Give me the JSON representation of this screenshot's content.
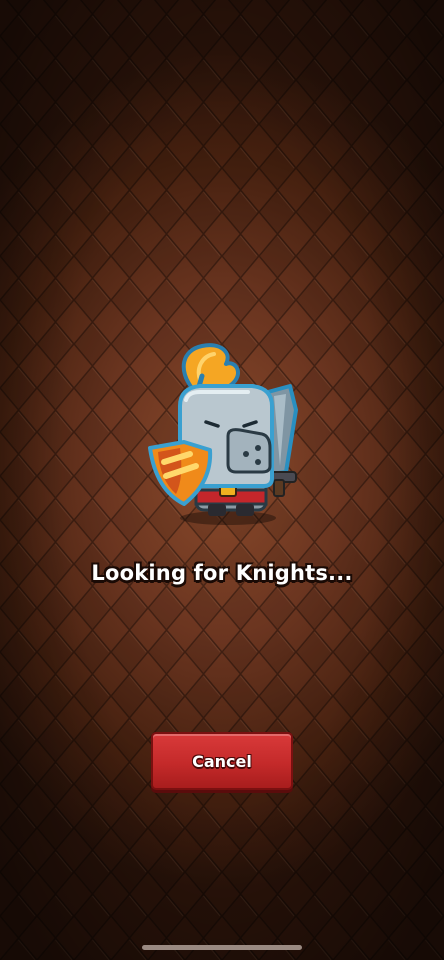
{
  "matchmaking": {
    "status_text": "Looking for Knights...",
    "cancel_label": "Cancel"
  },
  "character": {
    "icon": "knight-icon",
    "items": [
      "plume-icon",
      "shield-icon",
      "sword-icon"
    ]
  },
  "colors": {
    "background": "#6b3520",
    "button": "#c42a2a",
    "plume": "#f5a623",
    "armor": "#b9c7cf"
  }
}
